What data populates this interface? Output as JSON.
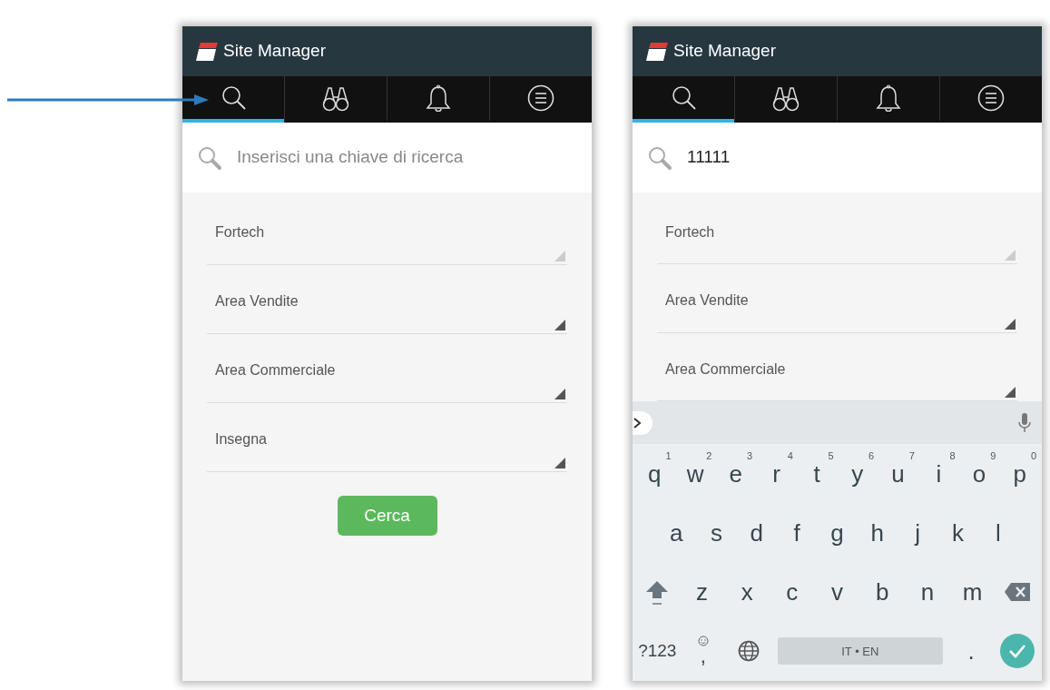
{
  "screens": [
    {
      "app_title": "Site Manager",
      "tabs": [
        {
          "kind": "search",
          "selected": true
        },
        {
          "kind": "binoculars",
          "selected": false
        },
        {
          "kind": "bell",
          "selected": false
        },
        {
          "kind": "menu",
          "selected": false
        }
      ],
      "search": {
        "placeholder": "Inserisci una chiave di ricerca"
      },
      "dropdowns": [
        {
          "label": "Fortech",
          "disabled": true
        },
        {
          "label": "Area Vendite",
          "disabled": false
        },
        {
          "label": "Area Commerciale",
          "disabled": false
        },
        {
          "label": "Insegna",
          "disabled": false
        }
      ],
      "button": "Cerca"
    },
    {
      "app_title": "Site Manager",
      "tabs": [
        {
          "kind": "search",
          "selected": true
        },
        {
          "kind": "binoculars",
          "selected": false
        },
        {
          "kind": "bell",
          "selected": false
        },
        {
          "kind": "menu",
          "selected": false
        }
      ],
      "search": {
        "value": "11111"
      },
      "dropdowns": [
        {
          "label": "Fortech",
          "disabled": true
        },
        {
          "label": "Area Vendite",
          "disabled": false
        },
        {
          "label": "Area Commerciale",
          "disabled": false
        }
      ],
      "keyboard": {
        "rows": [
          [
            {
              "kind": "char",
              "label": "q",
              "hint": "1"
            },
            {
              "kind": "char",
              "label": "w",
              "hint": "2"
            },
            {
              "kind": "char",
              "label": "e",
              "hint": "3"
            },
            {
              "kind": "char",
              "label": "r",
              "hint": "4"
            },
            {
              "kind": "char",
              "label": "t",
              "hint": "5"
            },
            {
              "kind": "char",
              "label": "y",
              "hint": "6"
            },
            {
              "kind": "char",
              "label": "u",
              "hint": "7"
            },
            {
              "kind": "char",
              "label": "i",
              "hint": "8"
            },
            {
              "kind": "char",
              "label": "o",
              "hint": "9"
            },
            {
              "kind": "char",
              "label": "p",
              "hint": "0"
            }
          ],
          [
            {
              "kind": "char",
              "label": "a"
            },
            {
              "kind": "char",
              "label": "s"
            },
            {
              "kind": "char",
              "label": "d"
            },
            {
              "kind": "char",
              "label": "f"
            },
            {
              "kind": "char",
              "label": "g"
            },
            {
              "kind": "char",
              "label": "h"
            },
            {
              "kind": "char",
              "label": "j"
            },
            {
              "kind": "char",
              "label": "k"
            },
            {
              "kind": "char",
              "label": "l"
            }
          ],
          [
            {
              "kind": "shift"
            },
            {
              "kind": "char",
              "label": "z"
            },
            {
              "kind": "char",
              "label": "x"
            },
            {
              "kind": "char",
              "label": "c"
            },
            {
              "kind": "char",
              "label": "v"
            },
            {
              "kind": "char",
              "label": "b"
            },
            {
              "kind": "char",
              "label": "n"
            },
            {
              "kind": "char",
              "label": "m"
            },
            {
              "kind": "backspace"
            }
          ],
          [
            {
              "kind": "symbols",
              "label": "?123"
            },
            {
              "kind": "emoji_comma",
              "label": ","
            },
            {
              "kind": "globe"
            },
            {
              "kind": "space",
              "label": "IT • EN"
            },
            {
              "kind": "char",
              "label": "."
            },
            {
              "kind": "enter"
            }
          ]
        ]
      }
    }
  ]
}
